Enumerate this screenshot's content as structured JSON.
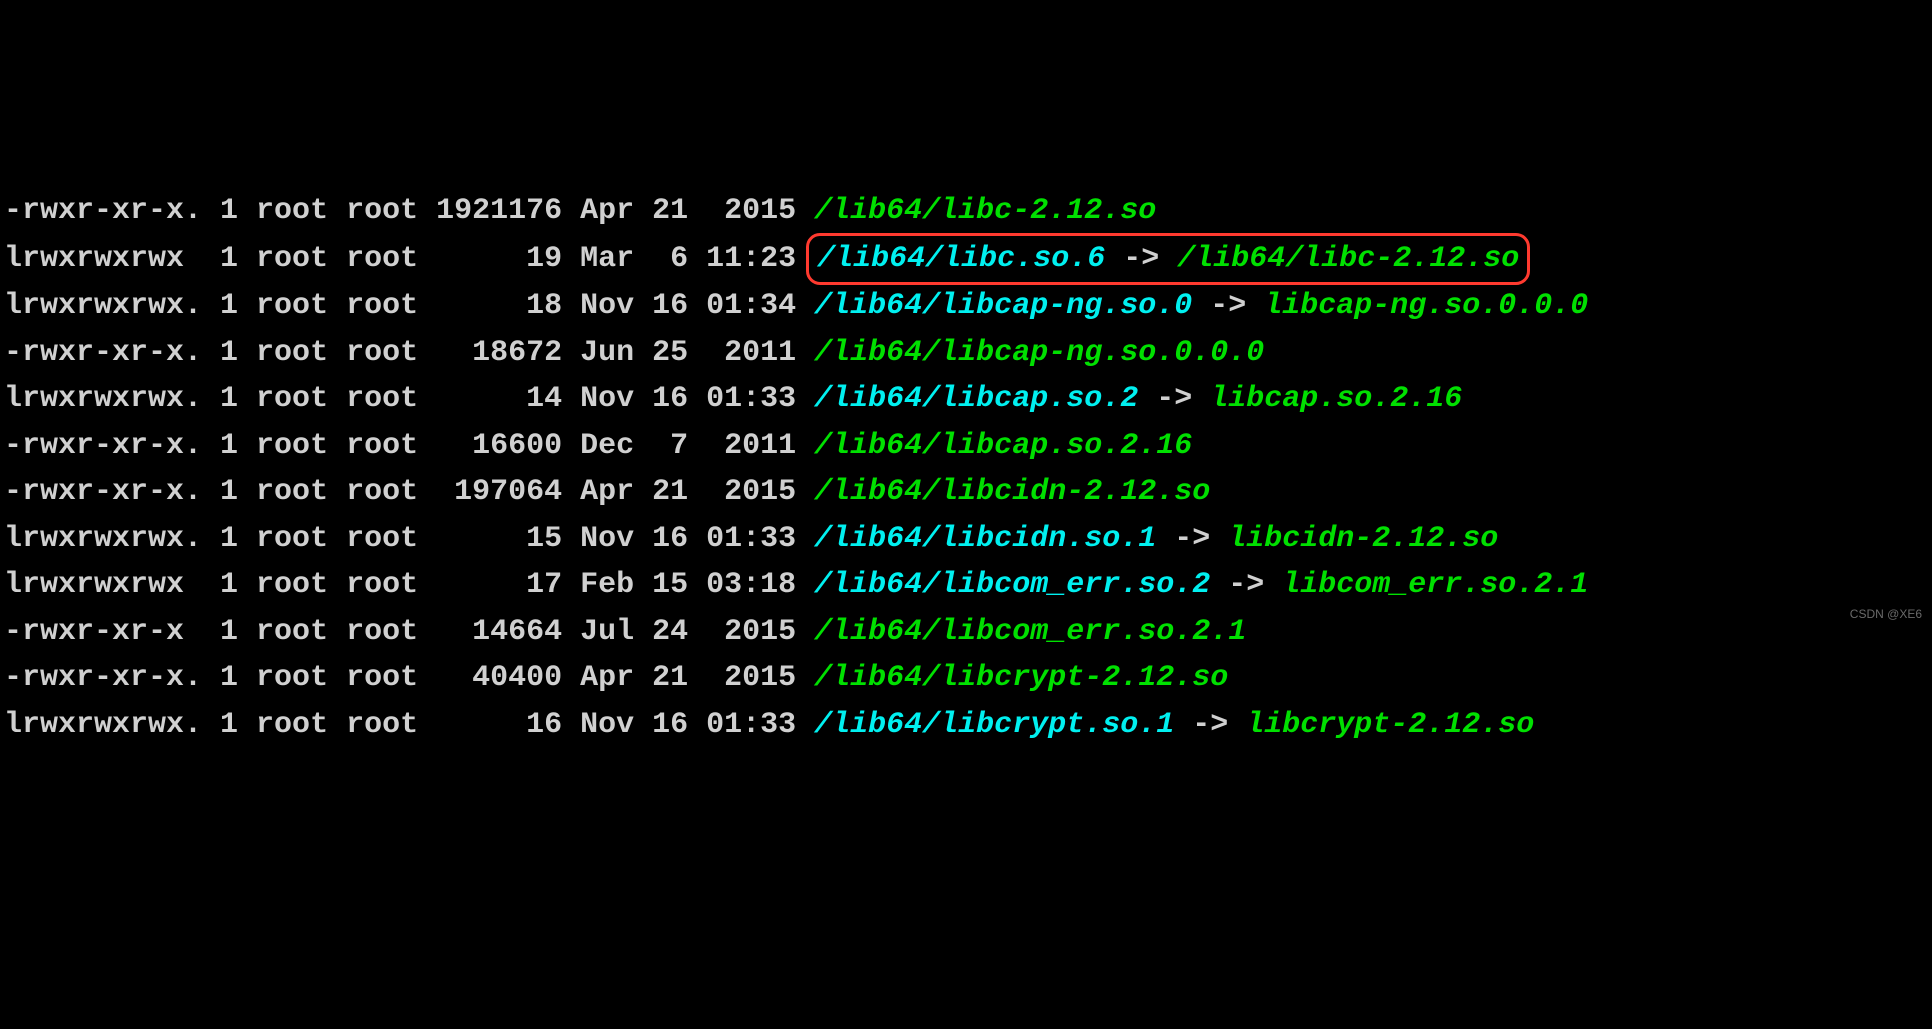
{
  "rows": [
    {
      "perms": "-rwxr-xr-x.",
      "links": "1",
      "owner": "root",
      "group": "root",
      "size": "1921176",
      "month": "Apr",
      "day": "21",
      "time": " 2015",
      "path": "/lib64/libc-2.12.so",
      "is_symlink": false,
      "target": "",
      "highlighted": false
    },
    {
      "perms": "lrwxrwxrwx ",
      "links": "1",
      "owner": "root",
      "group": "root",
      "size": "     19",
      "month": "Mar",
      "day": " 6",
      "time": "11:23",
      "path": "/lib64/libc.so.6",
      "is_symlink": true,
      "target": "/lib64/libc-2.12.so",
      "highlighted": true
    },
    {
      "perms": "lrwxrwxrwx.",
      "links": "1",
      "owner": "root",
      "group": "root",
      "size": "     18",
      "month": "Nov",
      "day": "16",
      "time": "01:34",
      "path": "/lib64/libcap-ng.so.0",
      "is_symlink": true,
      "target": "libcap-ng.so.0.0.0",
      "highlighted": false
    },
    {
      "perms": "-rwxr-xr-x.",
      "links": "1",
      "owner": "root",
      "group": "root",
      "size": "  18672",
      "month": "Jun",
      "day": "25",
      "time": " 2011",
      "path": "/lib64/libcap-ng.so.0.0.0",
      "is_symlink": false,
      "target": "",
      "highlighted": false
    },
    {
      "perms": "lrwxrwxrwx.",
      "links": "1",
      "owner": "root",
      "group": "root",
      "size": "     14",
      "month": "Nov",
      "day": "16",
      "time": "01:33",
      "path": "/lib64/libcap.so.2",
      "is_symlink": true,
      "target": "libcap.so.2.16",
      "highlighted": false
    },
    {
      "perms": "-rwxr-xr-x.",
      "links": "1",
      "owner": "root",
      "group": "root",
      "size": "  16600",
      "month": "Dec",
      "day": " 7",
      "time": " 2011",
      "path": "/lib64/libcap.so.2.16",
      "is_symlink": false,
      "target": "",
      "highlighted": false
    },
    {
      "perms": "-rwxr-xr-x.",
      "links": "1",
      "owner": "root",
      "group": "root",
      "size": " 197064",
      "month": "Apr",
      "day": "21",
      "time": " 2015",
      "path": "/lib64/libcidn-2.12.so",
      "is_symlink": false,
      "target": "",
      "highlighted": false
    },
    {
      "perms": "lrwxrwxrwx.",
      "links": "1",
      "owner": "root",
      "group": "root",
      "size": "     15",
      "month": "Nov",
      "day": "16",
      "time": "01:33",
      "path": "/lib64/libcidn.so.1",
      "is_symlink": true,
      "target": "libcidn-2.12.so",
      "highlighted": false
    },
    {
      "perms": "lrwxrwxrwx ",
      "links": "1",
      "owner": "root",
      "group": "root",
      "size": "     17",
      "month": "Feb",
      "day": "15",
      "time": "03:18",
      "path": "/lib64/libcom_err.so.2",
      "is_symlink": true,
      "target": "libcom_err.so.2.1",
      "highlighted": false
    },
    {
      "perms": "-rwxr-xr-x ",
      "links": "1",
      "owner": "root",
      "group": "root",
      "size": "  14664",
      "month": "Jul",
      "day": "24",
      "time": " 2015",
      "path": "/lib64/libcom_err.so.2.1",
      "is_symlink": false,
      "target": "",
      "highlighted": false
    },
    {
      "perms": "-rwxr-xr-x.",
      "links": "1",
      "owner": "root",
      "group": "root",
      "size": "  40400",
      "month": "Apr",
      "day": "21",
      "time": " 2015",
      "path": "/lib64/libcrypt-2.12.so",
      "is_symlink": false,
      "target": "",
      "highlighted": false
    },
    {
      "perms": "lrwxrwxrwx.",
      "links": "1",
      "owner": "root",
      "group": "root",
      "size": "     16",
      "month": "Nov",
      "day": "16",
      "time": "01:33",
      "path": "/lib64/libcrypt.so.1",
      "is_symlink": true,
      "target": "libcrypt-2.12.so",
      "highlighted": false
    }
  ],
  "arrow": " -> ",
  "watermark": "CSDN @XE6"
}
